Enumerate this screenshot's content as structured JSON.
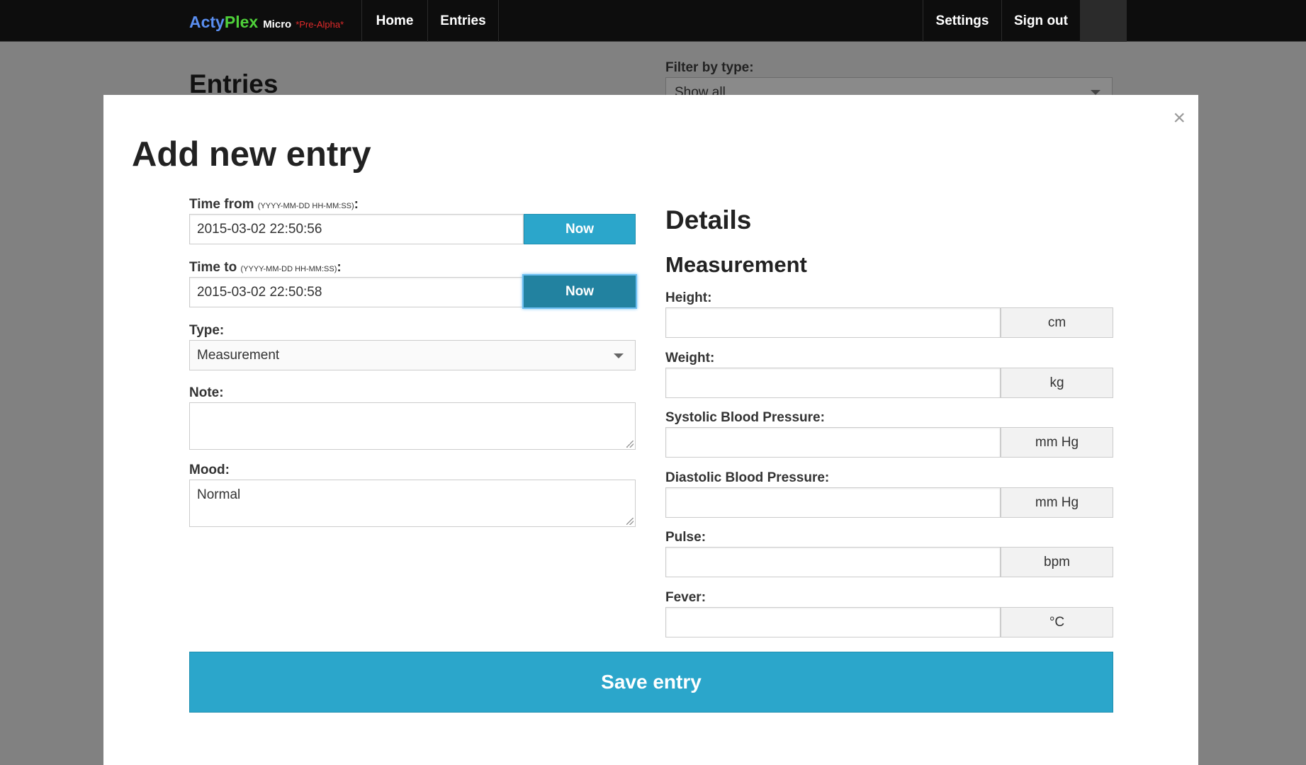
{
  "nav": {
    "brand_part1": "Acty",
    "brand_part2": "Plex",
    "brand_micro": "Micro",
    "brand_tag": "*Pre-Alpha*",
    "home": "Home",
    "entries": "Entries",
    "settings": "Settings",
    "signout": "Sign out"
  },
  "background": {
    "title": "Entries",
    "filter_label": "Filter by type:",
    "filter_value": "Show all"
  },
  "modal": {
    "title": "Add new entry",
    "close": "×",
    "time_from": {
      "label": "Time from",
      "hint": "(YYYY-MM-DD HH-MM:SS)",
      "colon": ":",
      "value": "2015-03-02 22:50:56",
      "button": "Now"
    },
    "time_to": {
      "label": "Time to",
      "hint": "(YYYY-MM-DD HH-MM:SS)",
      "colon": ":",
      "value": "2015-03-02 22:50:58",
      "button": "Now"
    },
    "type": {
      "label": "Type:",
      "value": "Measurement"
    },
    "note": {
      "label": "Note:",
      "value": ""
    },
    "mood": {
      "label": "Mood:",
      "value": "Normal"
    },
    "details_heading": "Details",
    "measurement_heading": "Measurement",
    "fields": [
      {
        "label": "Height:",
        "value": "",
        "unit": "cm"
      },
      {
        "label": "Weight:",
        "value": "",
        "unit": "kg"
      },
      {
        "label": "Systolic Blood Pressure:",
        "value": "",
        "unit": "mm Hg"
      },
      {
        "label": "Diastolic Blood Pressure:",
        "value": "",
        "unit": "mm Hg"
      },
      {
        "label": "Pulse:",
        "value": "",
        "unit": "bpm"
      },
      {
        "label": "Fever:",
        "value": "",
        "unit": "°C"
      }
    ],
    "save": "Save entry"
  },
  "colors": {
    "accent": "#2ba6cb",
    "accent_dark": "#2282a0",
    "navbar": "#0d0d0d",
    "overlay": "#818181"
  }
}
